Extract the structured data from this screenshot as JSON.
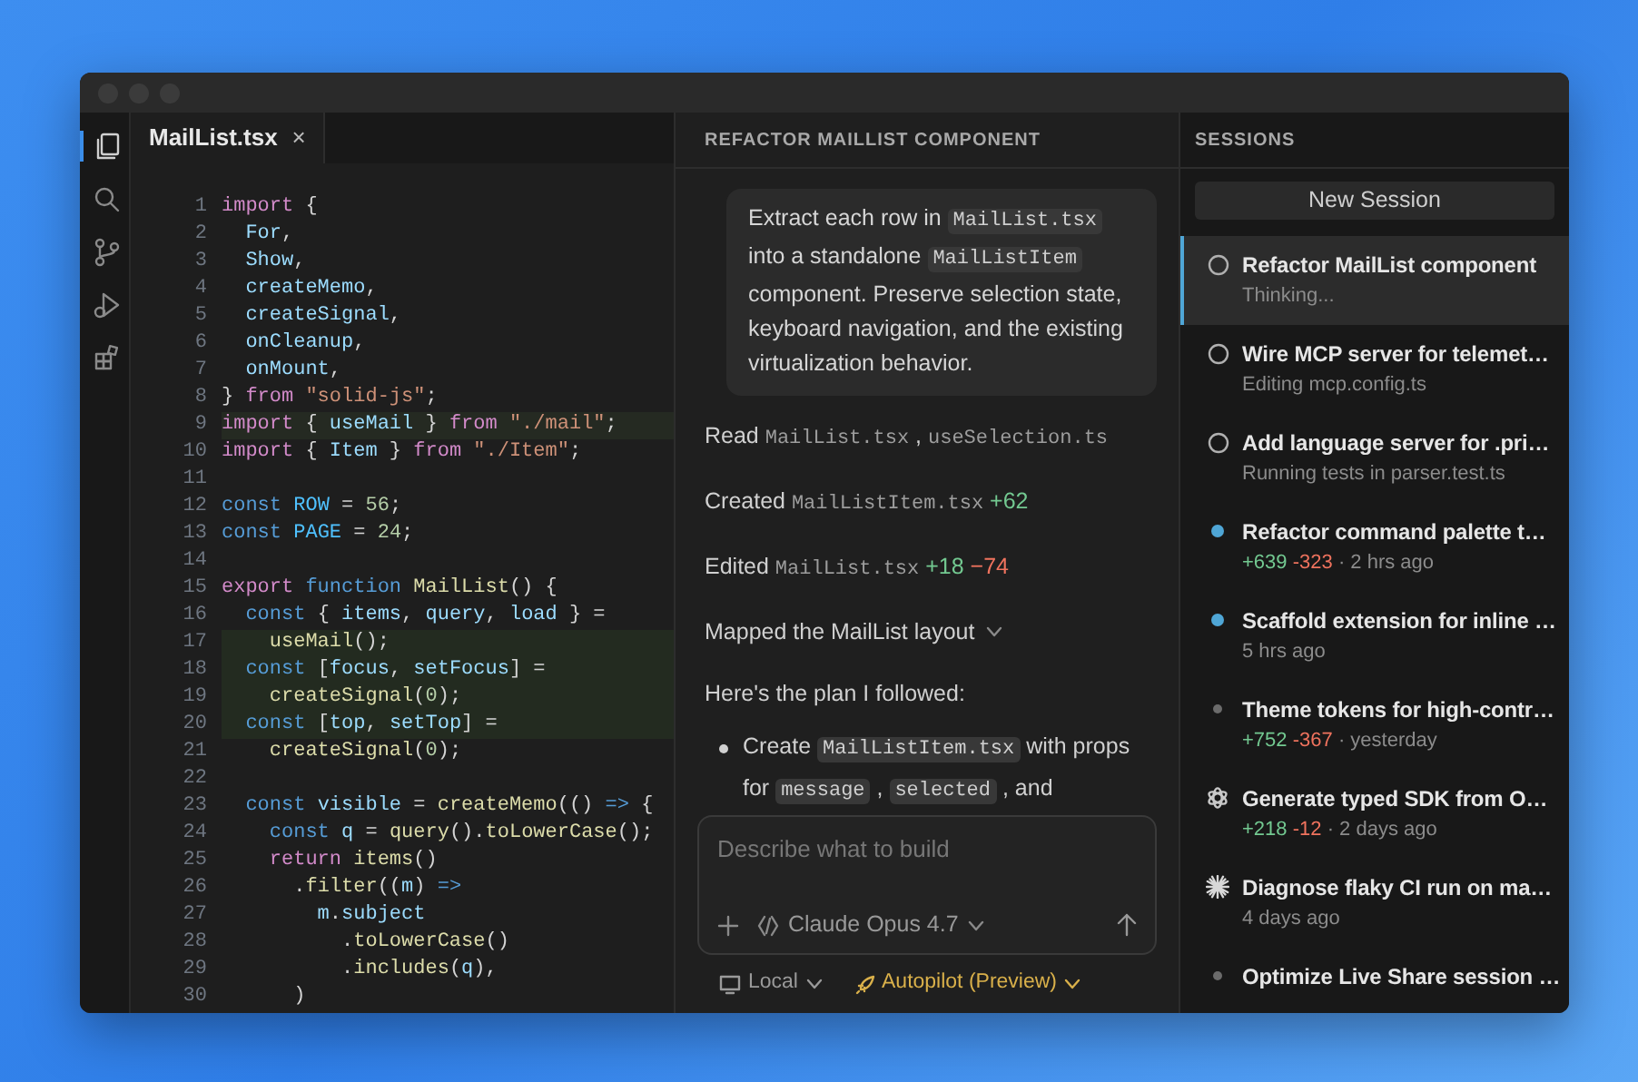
{
  "activity_bar": [
    {
      "kind": "files",
      "selected": true
    },
    {
      "kind": "search",
      "selected": false
    },
    {
      "kind": "branch",
      "selected": false
    },
    {
      "kind": "run",
      "selected": false
    },
    {
      "kind": "extensions",
      "selected": false
    }
  ],
  "editor": {
    "tabs": [
      {
        "label": "MailList.tsx",
        "selected": true,
        "close": "×"
      }
    ],
    "lines": [
      {
        "number": "1",
        "tokens": [
          {
            "kind": "kw",
            "text": "import"
          },
          {
            "kind": "p",
            "text": " {"
          }
        ]
      },
      {
        "number": "2",
        "tokens": [
          {
            "kind": "var",
            "text": "  For"
          },
          {
            "kind": "p",
            "text": ","
          }
        ]
      },
      {
        "number": "3",
        "tokens": [
          {
            "kind": "var",
            "text": "  Show"
          },
          {
            "kind": "p",
            "text": ","
          }
        ]
      },
      {
        "number": "4",
        "tokens": [
          {
            "kind": "var",
            "text": "  createMemo"
          },
          {
            "kind": "p",
            "text": ","
          }
        ]
      },
      {
        "number": "5",
        "tokens": [
          {
            "kind": "var",
            "text": "  createSignal"
          },
          {
            "kind": "p",
            "text": ","
          }
        ]
      },
      {
        "number": "6",
        "tokens": [
          {
            "kind": "var",
            "text": "  onCleanup"
          },
          {
            "kind": "p",
            "text": ","
          }
        ]
      },
      {
        "number": "7",
        "tokens": [
          {
            "kind": "var",
            "text": "  onMount"
          },
          {
            "kind": "p",
            "text": ","
          }
        ]
      },
      {
        "number": "8",
        "tokens": [
          {
            "kind": "p",
            "text": "} "
          },
          {
            "kind": "kw",
            "text": "from"
          },
          {
            "kind": "str",
            "text": " \"solid-js\""
          },
          {
            "kind": "p",
            "text": ";"
          }
        ]
      },
      {
        "number": "9",
        "current": true,
        "tokens": [
          {
            "kind": "kw",
            "text": "import"
          },
          {
            "kind": "p",
            "text": " { "
          },
          {
            "kind": "var",
            "text": "useMail"
          },
          {
            "kind": "p",
            "text": " } "
          },
          {
            "kind": "kw",
            "text": "from"
          },
          {
            "kind": "str",
            "text": " \"./mail\""
          },
          {
            "kind": "p",
            "text": ";"
          }
        ]
      },
      {
        "number": "10",
        "tokens": [
          {
            "kind": "kw",
            "text": "import"
          },
          {
            "kind": "p",
            "text": " { "
          },
          {
            "kind": "var",
            "text": "Item"
          },
          {
            "kind": "p",
            "text": " } "
          },
          {
            "kind": "kw",
            "text": "from"
          },
          {
            "kind": "str",
            "text": " \"./Item\""
          },
          {
            "kind": "p",
            "text": ";"
          }
        ]
      },
      {
        "number": "11"
      },
      {
        "number": "12",
        "tokens": [
          {
            "kind": "st",
            "text": "const"
          },
          {
            "kind": "cst",
            "text": " ROW"
          },
          {
            "kind": "p",
            "text": " = "
          },
          {
            "kind": "num",
            "text": "56"
          },
          {
            "kind": "p",
            "text": ";"
          }
        ]
      },
      {
        "number": "13",
        "tokens": [
          {
            "kind": "st",
            "text": "const"
          },
          {
            "kind": "cst",
            "text": " PAGE"
          },
          {
            "kind": "p",
            "text": " = "
          },
          {
            "kind": "num",
            "text": "24"
          },
          {
            "kind": "p",
            "text": ";"
          }
        ]
      },
      {
        "number": "14"
      },
      {
        "number": "15",
        "tokens": [
          {
            "kind": "kw",
            "text": "export"
          },
          {
            "kind": "st",
            "text": " function"
          },
          {
            "kind": "fn",
            "text": " MailList"
          },
          {
            "kind": "p",
            "text": "() {"
          }
        ]
      },
      {
        "number": "16",
        "tokens": [
          {
            "kind": "st",
            "text": "  const"
          },
          {
            "kind": "p",
            "text": " { "
          },
          {
            "kind": "var",
            "text": "items"
          },
          {
            "kind": "p",
            "text": ", "
          },
          {
            "kind": "var",
            "text": "query"
          },
          {
            "kind": "p",
            "text": ", "
          },
          {
            "kind": "var",
            "text": "load"
          },
          {
            "kind": "p",
            "text": " } ="
          }
        ]
      },
      {
        "number": "17",
        "changed": true,
        "tokens": [
          {
            "kind": "fn",
            "text": "    useMail"
          },
          {
            "kind": "p",
            "text": "();"
          }
        ]
      },
      {
        "number": "18",
        "changed": true,
        "tokens": [
          {
            "kind": "st",
            "text": "  const"
          },
          {
            "kind": "p",
            "text": " ["
          },
          {
            "kind": "var",
            "text": "focus"
          },
          {
            "kind": "p",
            "text": ", "
          },
          {
            "kind": "var",
            "text": "setFocus"
          },
          {
            "kind": "p",
            "text": "] ="
          }
        ]
      },
      {
        "number": "19",
        "changed": true,
        "tokens": [
          {
            "kind": "fn",
            "text": "    createSignal"
          },
          {
            "kind": "p",
            "text": "("
          },
          {
            "kind": "num",
            "text": "0"
          },
          {
            "kind": "p",
            "text": ");"
          }
        ]
      },
      {
        "number": "20",
        "changed": true,
        "tokens": [
          {
            "kind": "st",
            "text": "  const"
          },
          {
            "kind": "p",
            "text": " ["
          },
          {
            "kind": "var",
            "text": "top"
          },
          {
            "kind": "p",
            "text": ", "
          },
          {
            "kind": "var",
            "text": "setTop"
          },
          {
            "kind": "p",
            "text": "] ="
          }
        ]
      },
      {
        "number": "21",
        "tokens": [
          {
            "kind": "fn",
            "text": "    createSignal"
          },
          {
            "kind": "p",
            "text": "("
          },
          {
            "kind": "num",
            "text": "0"
          },
          {
            "kind": "p",
            "text": ");"
          }
        ]
      },
      {
        "number": "22"
      },
      {
        "number": "23",
        "tokens": [
          {
            "kind": "st",
            "text": "  const"
          },
          {
            "kind": "var",
            "text": " visible"
          },
          {
            "kind": "p",
            "text": " = "
          },
          {
            "kind": "fn",
            "text": "createMemo"
          },
          {
            "kind": "p",
            "text": "(() "
          },
          {
            "kind": "st",
            "text": "=>"
          },
          {
            "kind": "p",
            "text": " {"
          }
        ]
      },
      {
        "number": "24",
        "tokens": [
          {
            "kind": "st",
            "text": "    const"
          },
          {
            "kind": "var",
            "text": " q"
          },
          {
            "kind": "p",
            "text": " = "
          },
          {
            "kind": "fn",
            "text": "query"
          },
          {
            "kind": "p",
            "text": "()."
          },
          {
            "kind": "fn",
            "text": "toLowerCase"
          },
          {
            "kind": "p",
            "text": "();"
          }
        ]
      },
      {
        "number": "25",
        "tokens": [
          {
            "kind": "kw",
            "text": "    return"
          },
          {
            "kind": "fn",
            "text": " items"
          },
          {
            "kind": "p",
            "text": "()"
          }
        ]
      },
      {
        "number": "26",
        "tokens": [
          {
            "kind": "p",
            "text": "      ."
          },
          {
            "kind": "fn",
            "text": "filter"
          },
          {
            "kind": "p",
            "text": "(("
          },
          {
            "kind": "var",
            "text": "m"
          },
          {
            "kind": "p",
            "text": ") "
          },
          {
            "kind": "st",
            "text": "=>"
          }
        ]
      },
      {
        "number": "27",
        "tokens": [
          {
            "kind": "var",
            "text": "        m"
          },
          {
            "kind": "p",
            "text": "."
          },
          {
            "kind": "var",
            "text": "subject"
          }
        ]
      },
      {
        "number": "28",
        "tokens": [
          {
            "kind": "p",
            "text": "          ."
          },
          {
            "kind": "fn",
            "text": "toLowerCase"
          },
          {
            "kind": "p",
            "text": "()"
          }
        ]
      },
      {
        "number": "29",
        "tokens": [
          {
            "kind": "p",
            "text": "          ."
          },
          {
            "kind": "fn",
            "text": "includes"
          },
          {
            "kind": "p",
            "text": "("
          },
          {
            "kind": "var",
            "text": "q"
          },
          {
            "kind": "p",
            "text": "),"
          }
        ]
      },
      {
        "number": "30",
        "tokens": [
          {
            "kind": "p",
            "text": "      )"
          }
        ]
      }
    ]
  },
  "chat": {
    "title": "REFACTOR MAILLIST COMPONENT",
    "prompt": [
      {
        "kind": "text",
        "text": "Extract each row in "
      },
      {
        "kind": "code",
        "text": "MailList.tsx"
      },
      {
        "kind": "text",
        "text": " into a standalone "
      },
      {
        "kind": "code",
        "text": "MailListItem"
      },
      {
        "kind": "text",
        "text": " component. Preserve selection state, keyboard navigation, and the existing virtualization behavior."
      }
    ],
    "blocks": [
      {
        "kind": "step",
        "parts": [
          {
            "kind": "text",
            "text": "Read "
          },
          {
            "kind": "file",
            "text": "MailList.tsx"
          },
          {
            "kind": "text",
            "text": " , "
          },
          {
            "kind": "file",
            "text": "useSelection.ts"
          }
        ]
      },
      {
        "kind": "step",
        "parts": [
          {
            "kind": "text",
            "text": "Created "
          },
          {
            "kind": "file",
            "text": "MailListItem.tsx"
          },
          {
            "kind": "added",
            "text": " +62"
          }
        ]
      },
      {
        "kind": "step",
        "parts": [
          {
            "kind": "text",
            "text": "Edited "
          },
          {
            "kind": "file",
            "text": "MailList.tsx"
          },
          {
            "kind": "added",
            "text": " +18"
          },
          {
            "kind": "removed",
            "text": " −74"
          }
        ]
      },
      {
        "kind": "collapsible",
        "text": "Mapped the MailList layout",
        "expanded": false
      },
      {
        "kind": "paragraph",
        "parts": [
          {
            "kind": "text",
            "text": "Here's the plan I followed:"
          }
        ]
      },
      {
        "kind": "bullet",
        "parts": [
          {
            "kind": "text",
            "text": "Create "
          },
          {
            "kind": "code",
            "text": "MailListItem.tsx"
          },
          {
            "kind": "text",
            "text": " with props for "
          },
          {
            "kind": "code",
            "text": "message"
          },
          {
            "kind": "text",
            "text": " , "
          },
          {
            "kind": "code",
            "text": "selected"
          },
          {
            "kind": "text",
            "text": " , and"
          }
        ]
      }
    ],
    "composer": {
      "placeholder": "Describe what to build",
      "model": "Claude Opus 4.7"
    },
    "footer": [
      {
        "kind": "location",
        "label": "Local"
      },
      {
        "kind": "mode",
        "label": "Autopilot (Preview)"
      }
    ]
  },
  "sessions": {
    "title": "SESSIONS",
    "new_button": "New Session",
    "items": [
      {
        "kind": "spinner",
        "title": "Refactor MailList component",
        "detail": "Thinking...",
        "selected": true
      },
      {
        "kind": "spinner",
        "title": "Wire MCP server for telemet…",
        "detail": "Editing mcp.config.ts",
        "selected": false
      },
      {
        "kind": "spinner",
        "title": "Add language server for .pri…",
        "detail": "Running tests in parser.test.ts",
        "selected": false
      },
      {
        "kind": "dot",
        "color": "#4fa6d6",
        "title": "Refactor command palette t…",
        "added": "+639",
        "removed": "-323",
        "time": "· 2 hrs ago",
        "selected": false
      },
      {
        "kind": "dot",
        "color": "#4fa6d6",
        "title": "Scaffold extension for inline …",
        "time": "5 hrs ago",
        "selected": false
      },
      {
        "kind": "dot",
        "color": "#6b6b6b",
        "title": "Theme tokens for high-contr…",
        "added": "+752",
        "removed": "-367",
        "time": "· yesterday",
        "selected": false
      },
      {
        "kind": "flower",
        "title": "Generate typed SDK from O…",
        "added": "+218",
        "removed": "-12",
        "time": "· 2 days ago",
        "selected": false
      },
      {
        "kind": "burst",
        "title": "Diagnose flaky CI run on ma…",
        "time": "4 days ago",
        "selected": false
      },
      {
        "kind": "dot",
        "color": "#6b6b6b",
        "title": "Optimize Live Share session …",
        "selected": false
      }
    ]
  }
}
